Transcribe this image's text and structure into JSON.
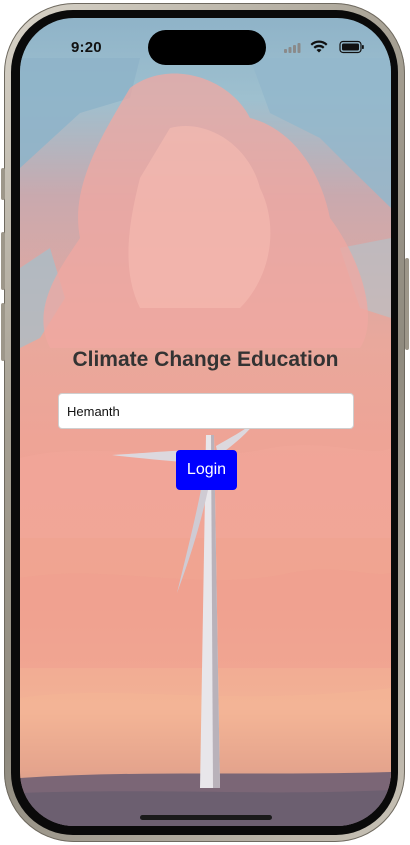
{
  "status_bar": {
    "time": "9:20",
    "icons": [
      "cellular-signal-icon",
      "wifi-icon",
      "battery-icon"
    ]
  },
  "app": {
    "title": "Climate Change Education",
    "username_field": {
      "value": "Hemanth"
    },
    "login_button_label": "Login"
  },
  "colors": {
    "title": "#333333",
    "button_bg": "#0000ff",
    "button_text": "#ffffff"
  },
  "background_image": "wind-turbine-pink-clouds-illustration"
}
